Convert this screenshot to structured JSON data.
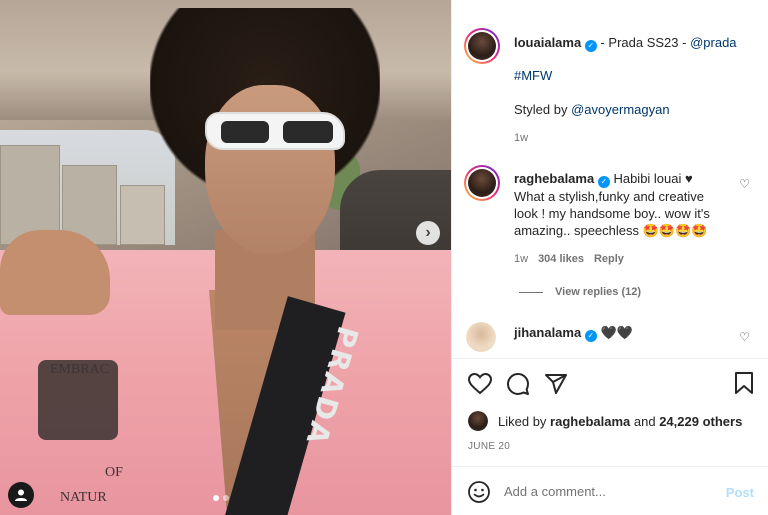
{
  "media": {
    "strap_text": "PRADA",
    "shirt_print_top": "EMBRAC",
    "shirt_print_of": "OF",
    "shirt_print_bottom": "NATUR",
    "next_icon": "chevron-right-icon",
    "carousel_count": 2,
    "carousel_active": 0
  },
  "caption": {
    "username": "louaialama",
    "verified_badge": "✓",
    "text": "- Prada SS23 -",
    "mention": "@prada",
    "hashtag": "#MFW",
    "styled_by": "Styled by",
    "stylist": "@avoyermagyan",
    "time": "1w"
  },
  "comments": [
    {
      "username": "raghebalama",
      "text_line1": "Habibi louai ♥",
      "text_line2": "What a stylish,funky and creative",
      "text_line3": "look ! my handsome boy.. wow it's",
      "text_line4": "amazing.. speechless 🤩🤩🤩🤩",
      "time": "1w",
      "likes": "304 likes",
      "reply": "Reply",
      "view_replies": "View replies (12)"
    },
    {
      "username": "jihanalama",
      "text": "🖤🖤"
    }
  ],
  "likes": {
    "prefix": "Liked by",
    "user": "raghebalama",
    "and": "and",
    "count": "24,229 others"
  },
  "date": "JUNE 20",
  "composer": {
    "placeholder": "Add a comment...",
    "post_label": "Post"
  }
}
